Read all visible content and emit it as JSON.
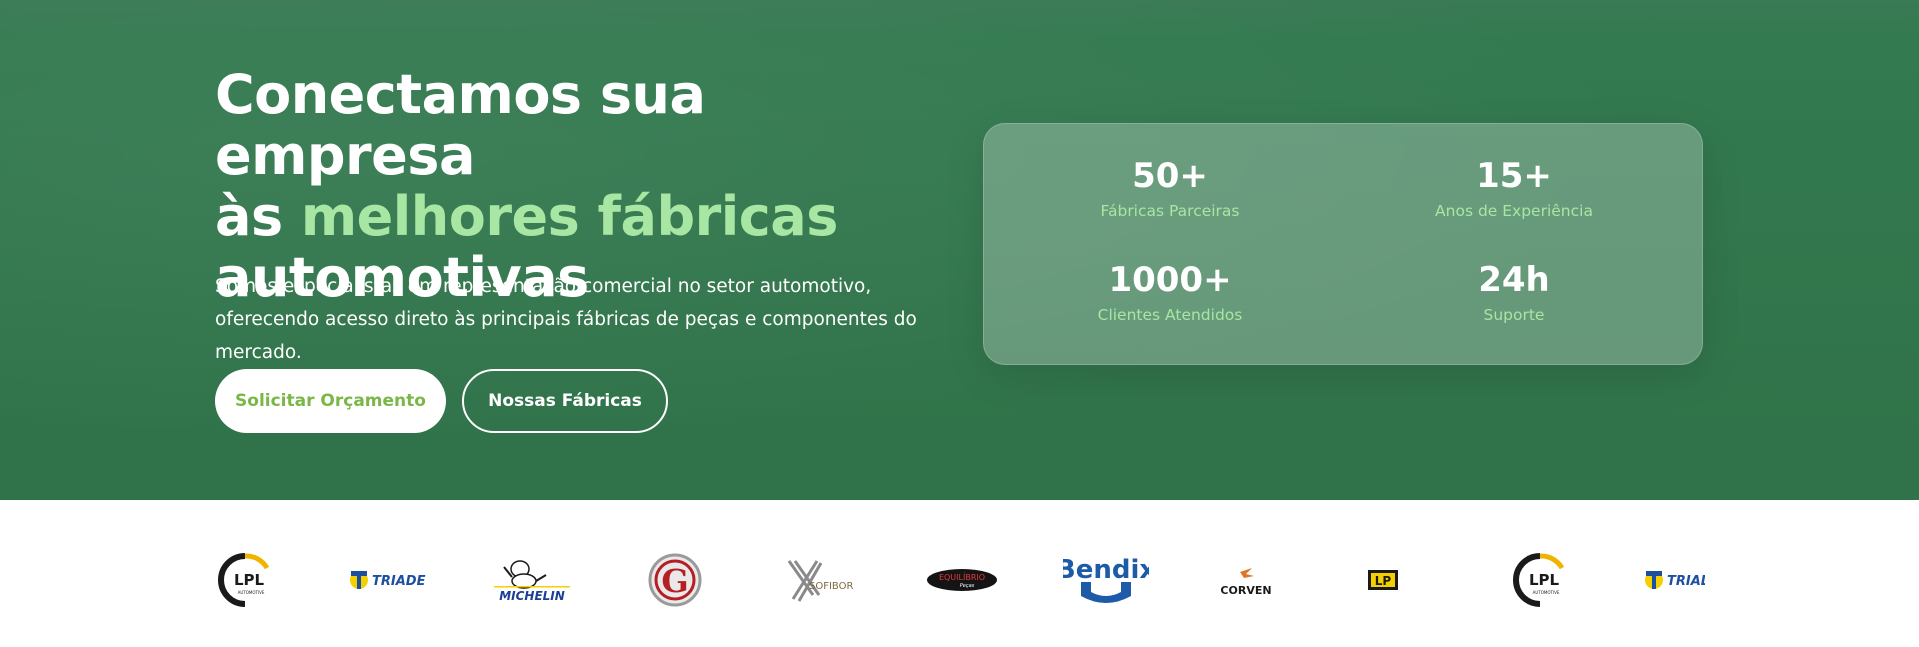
{
  "hero": {
    "headline_line1": "Conectamos sua empresa",
    "headline_prefix": "às ",
    "headline_accent": "melhores fábricas",
    "headline_line3": "automotivas",
    "subtitle": "Somos especialistas em representação comercial no setor automotivo, oferecendo acesso direto às principais fábricas de peças e componentes do mercado.",
    "primary_button": "Solicitar Orçamento",
    "secondary_button": "Nossas Fábricas"
  },
  "stats": [
    {
      "value": "50+",
      "label": "Fábricas Parceiras"
    },
    {
      "value": "15+",
      "label": "Anos de Experiência"
    },
    {
      "value": "1000+",
      "label": "Clientes Atendidos"
    },
    {
      "value": "24h",
      "label": "Suporte"
    }
  ],
  "logos": [
    {
      "name": "lpl-automotive-logo",
      "text": "LPL",
      "sub": "AUTOMOTIVE"
    },
    {
      "name": "triade-logo",
      "text": "TRIADE"
    },
    {
      "name": "michelin-logo",
      "text": "MICHELIN"
    },
    {
      "name": "g-logo",
      "text": "G"
    },
    {
      "name": "sofibor-logo",
      "text": "SOFIBOR"
    },
    {
      "name": "equilibrio-logo",
      "text": "EQUILÍBRIO"
    },
    {
      "name": "bendix-logo",
      "text": "Bendix"
    },
    {
      "name": "corven-logo",
      "text": "CORVEN"
    },
    {
      "name": "lp-logo",
      "text": "LP"
    },
    {
      "name": "lpl-automotive-logo-2",
      "text": "LPL",
      "sub": "AUTOMOTIVE"
    },
    {
      "name": "triade-logo-2",
      "text": "TRIADE"
    }
  ],
  "colors": {
    "hero_bg": "#337a50",
    "accent_green": "#a8e6a3",
    "button_text_green": "#7ab648",
    "white": "#ffffff"
  }
}
